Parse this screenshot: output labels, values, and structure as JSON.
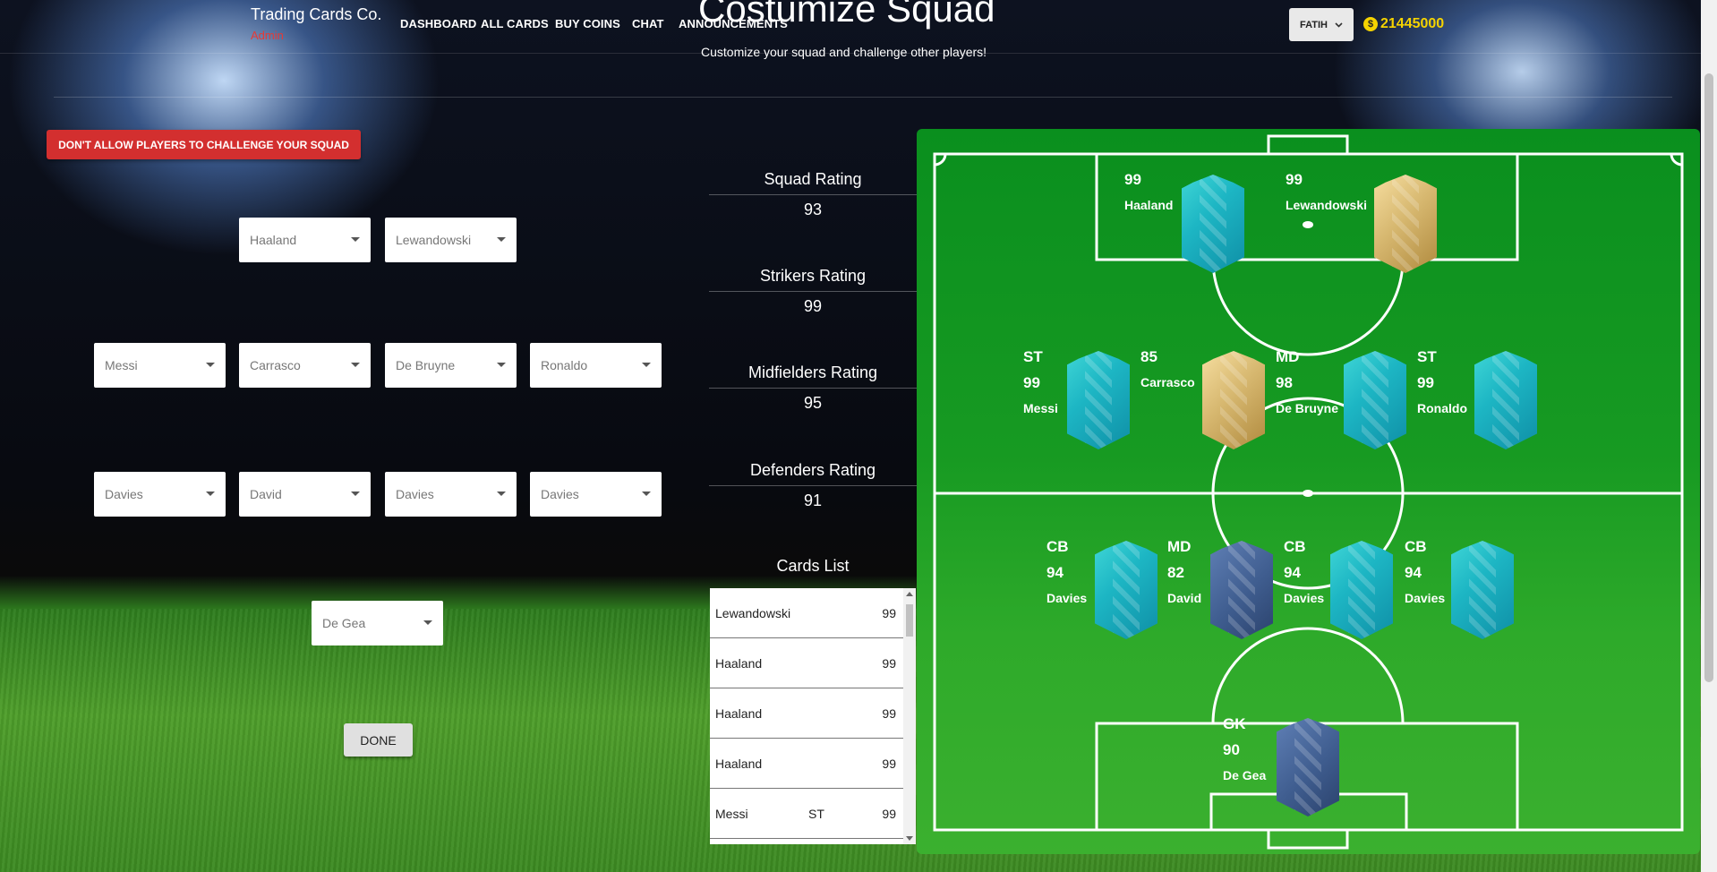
{
  "header": {
    "brand": "Trading Cards Co.",
    "brand_sub": "Admin",
    "nav": [
      "DASHBOARD",
      "ALL CARDS",
      "BUY COINS",
      "CHAT",
      "ANNOUNCEMENTS"
    ],
    "user": "FATIH",
    "coins": "21445000",
    "coin_symbol": "$"
  },
  "page": {
    "title": "Costumize Squad",
    "subtitle": "Customize your squad and challenge other players!"
  },
  "challenge_button": "DON'T ALLOW PLAYERS TO CHALLENGE YOUR SQUAD",
  "selectors": {
    "strikers": [
      "Haaland",
      "Lewandowski"
    ],
    "midfielders": [
      "Messi",
      "Carrasco",
      "De Bruyne",
      "Ronaldo"
    ],
    "defenders": [
      "Davies",
      "David",
      "Davies",
      "Davies"
    ],
    "goalkeeper": [
      "De Gea"
    ]
  },
  "done_button": "DONE",
  "ratings": [
    {
      "label": "Squad Rating",
      "value": "93"
    },
    {
      "label": "Strikers Rating",
      "value": "99"
    },
    {
      "label": "Midfielders Rating",
      "value": "95"
    },
    {
      "label": "Defenders Rating",
      "value": "91"
    }
  ],
  "cards_list": {
    "title": "Cards List",
    "rows": [
      {
        "name": "Lewandowski",
        "pos": "",
        "rating": "99"
      },
      {
        "name": "Haaland",
        "pos": "",
        "rating": "99"
      },
      {
        "name": "Haaland",
        "pos": "",
        "rating": "99"
      },
      {
        "name": "Haaland",
        "pos": "",
        "rating": "99"
      },
      {
        "name": "Messi",
        "pos": "ST",
        "rating": "99"
      }
    ]
  },
  "pitch_players": {
    "haaland": {
      "pos": "",
      "rating": "99",
      "name": "Haaland",
      "card": "teal"
    },
    "lewandowski": {
      "pos": "",
      "rating": "99",
      "name": "Lewandowski",
      "card": "gold"
    },
    "messi": {
      "pos": "ST",
      "rating": "99",
      "name": "Messi",
      "card": "teal"
    },
    "carrasco": {
      "pos": "",
      "rating": "85",
      "name": "Carrasco",
      "card": "gold"
    },
    "debruyne": {
      "pos": "MD",
      "rating": "98",
      "name": "De Bruyne",
      "card": "teal"
    },
    "ronaldo": {
      "pos": "ST",
      "rating": "99",
      "name": "Ronaldo",
      "card": "teal"
    },
    "davies1": {
      "pos": "CB",
      "rating": "94",
      "name": "Davies",
      "card": "teal"
    },
    "david": {
      "pos": "MD",
      "rating": "82",
      "name": "David",
      "card": "slate"
    },
    "davies2": {
      "pos": "CB",
      "rating": "94",
      "name": "Davies",
      "card": "teal"
    },
    "davies3": {
      "pos": "CB",
      "rating": "94",
      "name": "Davies",
      "card": "teal"
    },
    "degea": {
      "pos": "GK",
      "rating": "90",
      "name": "De Gea",
      "card": "slate"
    }
  },
  "colors": {
    "danger": "#d32f2f",
    "coins": "#f5d300",
    "pitch": "#179a22"
  }
}
